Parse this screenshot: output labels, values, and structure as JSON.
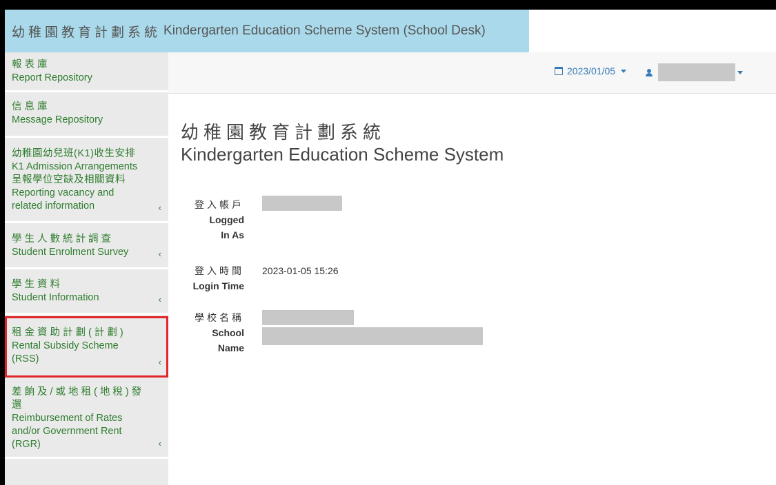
{
  "app": {
    "title_zh": "幼稚園教育計劃系統",
    "title_en": "Kindergarten Education Scheme System (School Desk)"
  },
  "sidebar": {
    "items": [
      {
        "zh": "報表庫",
        "en": "Report Repository",
        "chevron": ""
      },
      {
        "zh": "信息庫",
        "en": "Message Repository",
        "chevron": ""
      },
      {
        "zh": "幼稚園幼兒班(K1)收生安排",
        "en": "K1 Admission Arrangements",
        "zh2": "呈報學位空缺及相關資料",
        "en2": "Reporting vacancy and related information",
        "chevron": "‹"
      },
      {
        "zh": "學生人數統計調查",
        "en": "Student Enrolment Survey",
        "chevron": "‹"
      },
      {
        "zh": "學生資料",
        "en": "Student Information",
        "chevron": "‹"
      },
      {
        "zh": "租金資助計劃(計劃)",
        "en": "Rental Subsidy Scheme (RSS)",
        "chevron": "‹"
      },
      {
        "zh": "差餉及/或地租(地稅)發還",
        "en": "Reimbursement of Rates and/or Government Rent (RGR)",
        "chevron": "‹"
      }
    ]
  },
  "topnav": {
    "date": "2023/01/05",
    "icons": {
      "date": "calendar-icon",
      "user": "user-icon"
    }
  },
  "main": {
    "heading_zh": "幼稚園教育計劃系統",
    "heading_en": "Kindergarten Education Scheme System",
    "logged_in_as": {
      "label_zh": "登入帳戶",
      "label_en": "Logged In As",
      "value": ""
    },
    "login_time": {
      "label_zh": "登入時間",
      "label_en": "Login Time",
      "value": "2023-01-05 15:26"
    },
    "school_name": {
      "label_zh": "學校名稱",
      "label_en": "School Name",
      "value": ""
    }
  },
  "colors": {
    "accent": "#337ab7",
    "sidebar_text": "#2f7d2f",
    "title_bar": "#a9d9ea",
    "highlight": "#e0262b"
  }
}
